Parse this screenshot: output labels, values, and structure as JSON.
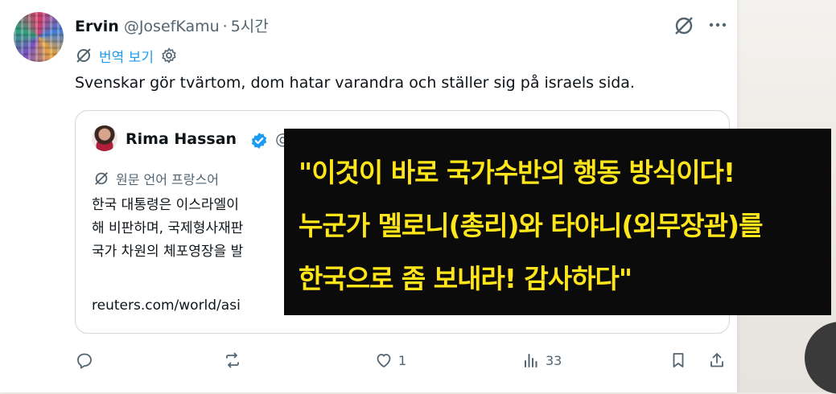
{
  "post": {
    "author_name": "Ervin",
    "handle": "@JosefKamu",
    "separator": "·",
    "time": "5시간",
    "translate_label": "번역 보기",
    "text": "Svenskar gör tvärtom, dom hatar varandra och ställer sig på israels sida."
  },
  "quote": {
    "author_name": "Rima Hassan",
    "handle_partial": "@",
    "original_language_label": "원문 언어 프랑스어",
    "body_lines": [
      "한국 대통령은 이스라엘이",
      "해 비판하며, 국제형사재판",
      "국가 차원의 체포영장을 발"
    ],
    "link": "reuters.com/world/asi"
  },
  "actions": {
    "reply_count": "",
    "repost_count": "",
    "like_count": "1",
    "views_count": "33"
  },
  "banner": {
    "lines": [
      "\"이것이 바로 국가수반의 행동 방식이다!",
      "누군가 멜로니(총리)와 타야니(외무장관)를",
      "한국으로 좀 보내라! 감사하다\""
    ]
  },
  "colors": {
    "link_blue": "#1d9bf0",
    "muted": "#536471",
    "banner_text": "#ffe61a",
    "banner_bg": "#0b0b0b"
  },
  "icons": [
    "grok-icon",
    "more-icon",
    "translate-icon",
    "settings-gear-icon",
    "verified-badge-icon",
    "reply-icon",
    "repost-icon",
    "like-icon",
    "views-icon",
    "bookmark-icon",
    "share-icon"
  ]
}
